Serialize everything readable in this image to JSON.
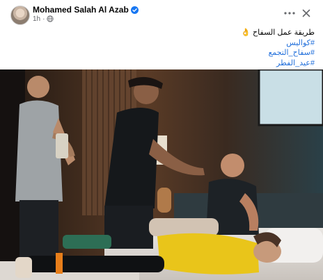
{
  "post": {
    "author": "Mohamed Salah Al Azab",
    "time": "1h",
    "caption_line": "طريقة عمل السفاح",
    "caption_emoji": "👌",
    "hashtags": [
      "#كواليس",
      "#سفاح_التجمع",
      "#عيد_الفطر"
    ]
  },
  "icons": {
    "avatar": "profile-photo",
    "verified": "verified-badge-icon",
    "privacy": "globe-icon",
    "more": "more-options-icon",
    "close": "close-icon"
  },
  "colors": {
    "name": "#050505",
    "meta": "#65676b",
    "link": "#216fdb",
    "verified": "#1877f2"
  }
}
